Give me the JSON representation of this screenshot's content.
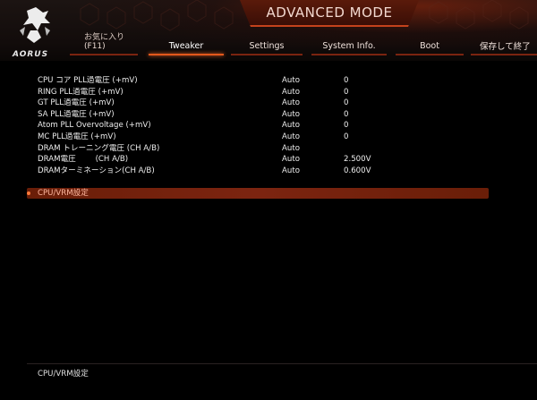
{
  "header": {
    "mode_title": "ADVANCED MODE",
    "logo_text": "AORUS",
    "accent_color": "#e2581c"
  },
  "tabs": [
    {
      "label": "お気に入り",
      "sublabel": "(F11)"
    },
    {
      "label": "Tweaker",
      "active": true
    },
    {
      "label": "Settings"
    },
    {
      "label": "System Info."
    },
    {
      "label": "Boot"
    },
    {
      "label": "保存して終了"
    }
  ],
  "settings": [
    {
      "name": "CPU コア PLL過電圧 (+mV)",
      "mode": "Auto",
      "value": "0"
    },
    {
      "name": "RING PLL過電圧 (+mV)",
      "mode": "Auto",
      "value": "0"
    },
    {
      "name": "GT PLL過電圧 (+mV)",
      "mode": "Auto",
      "value": "0"
    },
    {
      "name": "SA PLL過電圧 (+mV)",
      "mode": "Auto",
      "value": "0"
    },
    {
      "name": "Atom PLL Overvoltage (+mV)",
      "mode": "Auto",
      "value": "0"
    },
    {
      "name": "MC PLL過電圧 (+mV)",
      "mode": "Auto",
      "value": "0"
    },
    {
      "name": "DRAM トレーニング電圧 (CH A/B)",
      "mode": "Auto",
      "value": ""
    },
    {
      "name": "DRAM電圧        (CH A/B)",
      "mode": "Auto",
      "value": "2.500V"
    },
    {
      "name": "DRAMターミネーション(CH A/B)",
      "mode": "Auto",
      "value": "0.600V"
    }
  ],
  "submenu": {
    "label": "CPU/VRM設定"
  },
  "help": {
    "text": "CPU/VRM設定"
  }
}
